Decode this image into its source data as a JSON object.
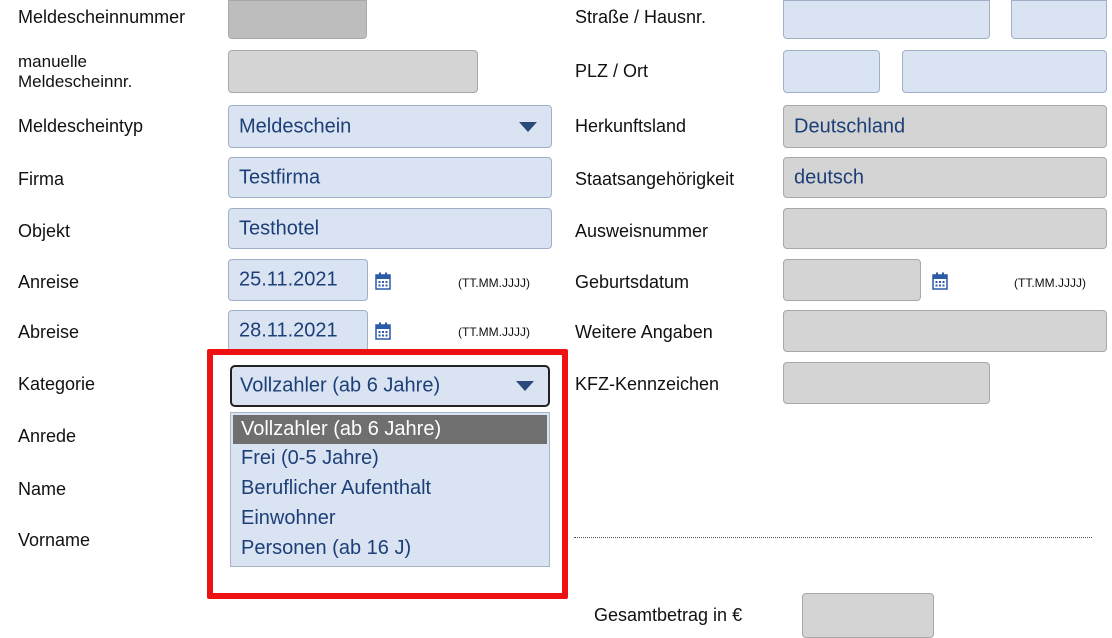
{
  "left_labels": {
    "meldescheinnummer": "Meldescheinnummer",
    "manuelle_line1": "manuelle",
    "manuelle_line2": "Meldescheinnr.",
    "meldescheintyp": "Meldescheintyp",
    "firma": "Firma",
    "objekt": "Objekt",
    "anreise": "Anreise",
    "abreise": "Abreise",
    "kategorie": "Kategorie",
    "anrede": "Anrede",
    "name": "Name",
    "vorname": "Vorname"
  },
  "right_labels": {
    "strasse": "Straße / Hausnr.",
    "plz": "PLZ / Ort",
    "herkunftsland": "Herkunftsland",
    "staatsangehoerigkeit": "Staatsangehörigkeit",
    "ausweisnummer": "Ausweisnummer",
    "geburtsdatum": "Geburtsdatum",
    "weitere_angaben": "Weitere Angaben",
    "kfz": "KFZ-Kennzeichen",
    "gesamtbetrag": "Gesamtbetrag in €"
  },
  "values": {
    "meldescheintyp": "Meldeschein",
    "firma": "Testfirma",
    "objekt": "Testhotel",
    "anreise": "25.11.2021",
    "abreise": "28.11.2021",
    "kategorie": "Vollzahler (ab 6 Jahre)",
    "herkunftsland": "Deutschland",
    "staatsangehoerigkeit": "deutsch"
  },
  "date_format": "(TT.MM.JJJJ)",
  "kategorie_options": [
    "Vollzahler (ab 6 Jahre)",
    "Frei (0-5 Jahre)",
    "Beruflicher Aufenthalt",
    "Einwohner",
    "Personen (ab 16 J)"
  ],
  "colors": {
    "field_blue": "#d9e3f2",
    "field_gray": "#d4d4d4",
    "value_text": "#1d3f78",
    "highlight": "#ee1111",
    "selected_option": "#6f6f6f"
  },
  "icons": {
    "calendar": "calendar-icon",
    "dropdown": "chevron-down-icon"
  }
}
